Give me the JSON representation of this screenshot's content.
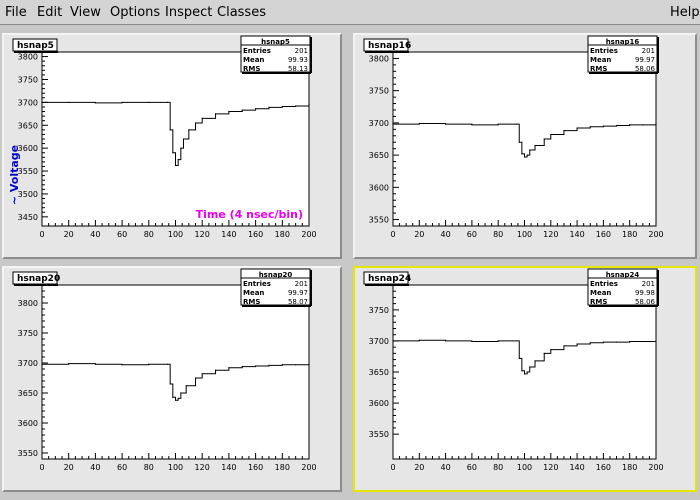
{
  "menu": {
    "file": "File",
    "edit": "Edit",
    "view": "View",
    "options": "Options",
    "inspect": "Inspect",
    "classes": "Classes",
    "help": "Help"
  },
  "colors": {
    "pad_bg": "#e6e6e6",
    "frame_bg": "#ffffff",
    "selected_border": "#e6e600",
    "ylabel": "#0000cc",
    "xlabel": "#ee00ee"
  },
  "annotations": {
    "ylabel": "~ Voltage",
    "xlabel": "Time  (4 nsec/bin)"
  },
  "pads": [
    {
      "title": "hsnap5",
      "stats": {
        "name": "hsnap5",
        "entries_label": "Entries",
        "entries": "201",
        "mean_label": "Mean",
        "mean": "99.93",
        "rms_label": "RMS",
        "rms": "58.13"
      },
      "selected": false,
      "has_annotations": true,
      "chart_data": {
        "type": "line",
        "xlim": [
          0,
          200
        ],
        "ylim": [
          3430,
          3810
        ],
        "xticks": [
          0,
          20,
          40,
          60,
          80,
          100,
          120,
          140,
          160,
          180,
          200
        ],
        "yticks": [
          3450,
          3500,
          3550,
          3600,
          3650,
          3700,
          3750,
          3800
        ],
        "x": [
          0,
          20,
          40,
          60,
          80,
          94,
          96,
          98,
          100,
          102,
          104,
          106,
          110,
          115,
          120,
          130,
          140,
          150,
          160,
          170,
          180,
          190,
          200
        ],
        "y": [
          3700,
          3700,
          3699,
          3700,
          3700,
          3700,
          3640,
          3590,
          3562,
          3575,
          3600,
          3620,
          3640,
          3655,
          3665,
          3675,
          3680,
          3683,
          3686,
          3689,
          3691,
          3692,
          3695
        ]
      }
    },
    {
      "title": "hsnap16",
      "stats": {
        "name": "hsnap16",
        "entries_label": "Entries",
        "entries": "201",
        "mean_label": "Mean",
        "mean": "99.97",
        "rms_label": "RMS",
        "rms": "58.06"
      },
      "selected": false,
      "has_annotations": false,
      "chart_data": {
        "type": "line",
        "xlim": [
          0,
          200
        ],
        "ylim": [
          3540,
          3810
        ],
        "xticks": [
          0,
          20,
          40,
          60,
          80,
          100,
          120,
          140,
          160,
          180,
          200
        ],
        "yticks": [
          3550,
          3600,
          3650,
          3700,
          3750,
          3800
        ],
        "x": [
          0,
          20,
          40,
          60,
          80,
          94,
          96,
          98,
          100,
          102,
          104,
          108,
          115,
          120,
          130,
          140,
          150,
          160,
          170,
          180,
          190,
          200
        ],
        "y": [
          3698,
          3699,
          3698,
          3697,
          3698,
          3698,
          3670,
          3652,
          3647,
          3650,
          3658,
          3665,
          3675,
          3682,
          3688,
          3692,
          3694,
          3695,
          3696,
          3697,
          3697,
          3698
        ]
      }
    },
    {
      "title": "hsnap20",
      "stats": {
        "name": "hsnap20",
        "entries_label": "Entries",
        "entries": "201",
        "mean_label": "Mean",
        "mean": "99.97",
        "rms_label": "RMS",
        "rms": "58.07"
      },
      "selected": false,
      "has_annotations": false,
      "chart_data": {
        "type": "line",
        "xlim": [
          0,
          200
        ],
        "ylim": [
          3540,
          3830
        ],
        "xticks": [
          0,
          20,
          40,
          60,
          80,
          100,
          120,
          140,
          160,
          180,
          200
        ],
        "yticks": [
          3550,
          3600,
          3650,
          3700,
          3750,
          3800
        ],
        "x": [
          0,
          20,
          40,
          60,
          80,
          94,
          96,
          98,
          100,
          102,
          104,
          108,
          115,
          120,
          130,
          140,
          150,
          160,
          170,
          180,
          190,
          200
        ],
        "y": [
          3698,
          3699,
          3698,
          3697,
          3698,
          3698,
          3665,
          3643,
          3638,
          3641,
          3650,
          3662,
          3675,
          3682,
          3688,
          3692,
          3694,
          3695,
          3696,
          3697,
          3697,
          3698
        ]
      }
    },
    {
      "title": "hsnap24",
      "stats": {
        "name": "hsnap24",
        "entries_label": "Entries",
        "entries": "201",
        "mean_label": "Mean",
        "mean": "99.98",
        "rms_label": "RMS",
        "rms": "58.06"
      },
      "selected": true,
      "has_annotations": false,
      "chart_data": {
        "type": "line",
        "xlim": [
          0,
          200
        ],
        "ylim": [
          3510,
          3790
        ],
        "xticks": [
          0,
          20,
          40,
          60,
          80,
          100,
          120,
          140,
          160,
          180,
          200
        ],
        "yticks": [
          3550,
          3600,
          3650,
          3700,
          3750
        ],
        "x": [
          0,
          20,
          40,
          60,
          80,
          94,
          96,
          98,
          100,
          102,
          104,
          108,
          115,
          120,
          130,
          140,
          150,
          160,
          170,
          180,
          190,
          200
        ],
        "y": [
          3700,
          3701,
          3700,
          3699,
          3700,
          3700,
          3672,
          3652,
          3647,
          3650,
          3658,
          3668,
          3680,
          3686,
          3692,
          3695,
          3697,
          3698,
          3698,
          3699,
          3699,
          3699
        ]
      }
    }
  ]
}
